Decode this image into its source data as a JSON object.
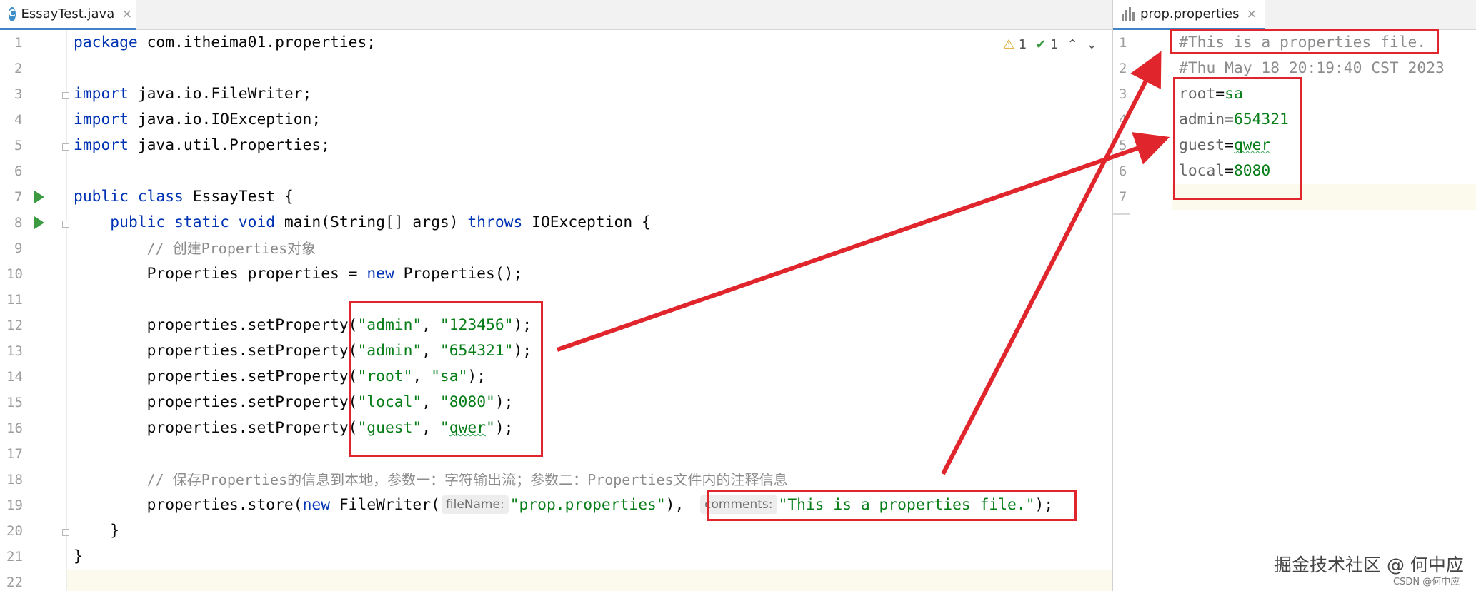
{
  "left_tab": {
    "icon": "java-class-icon",
    "label": "EssayTest.java",
    "close": "×"
  },
  "right_tab": {
    "icon": "properties-file-icon",
    "label": "prop.properties",
    "close": "×"
  },
  "inspections": {
    "warnings": "1",
    "weak_warnings": "1",
    "up": "⌃",
    "down": "⌄"
  },
  "editor": {
    "line_numbers": [
      "1",
      "2",
      "3",
      "4",
      "5",
      "6",
      "7",
      "8",
      "9",
      "10",
      "11",
      "12",
      "13",
      "14",
      "15",
      "16",
      "17",
      "18",
      "19",
      "20",
      "21",
      "22"
    ],
    "tokens": {
      "l1_kw": "package",
      "l1_rest": " com.itheima01.properties;",
      "l3_kw": "import",
      "l3_rest": " java.io.FileWriter;",
      "l4_kw": "import",
      "l4_rest": " java.io.IOException;",
      "l5_kw": "import",
      "l5_rest": " java.util.Properties;",
      "l7_kw": "public class",
      "l7_rest": " EssayTest {",
      "l8_indent": "    ",
      "l8_kw1": "public static void",
      "l8_mid": " main(String[] args) ",
      "l8_kw2": "throws",
      "l8_rest": " IOException {",
      "l9_indent": "        ",
      "l9_cmt": "// 创建Properties对象",
      "l10_indent": "        ",
      "l10_a": "Properties properties = ",
      "l10_kw": "new",
      "l10_b": " Properties();",
      "call_indent": "        ",
      "setProperty": "properties.setProperty(",
      "q": "\"",
      "comma": ", ",
      "close": ");",
      "l12_k": "\"admin\"",
      "l12_v": "\"123456\"",
      "l13_k": "\"admin\"",
      "l13_v": "\"654321\"",
      "l14_k": "\"root\"",
      "l14_v": "\"sa\"",
      "l15_k": "\"local\"",
      "l15_v": "\"8080\"",
      "l16_k": "\"guest\"",
      "l16_v_pre": "\"",
      "l16_v_word": "qwer",
      "l16_v_post": "\"",
      "l18_indent": "        ",
      "l18_cmt": "// 保存Properties的信息到本地，参数一：字符输出流；参数二：Properties文件内的注释信息",
      "l19_indent": "        ",
      "l19_a": "properties.store(",
      "l19_kw": "new",
      "l19_b": " FileWriter(",
      "l19_hint1": "fileName:",
      "l19_str1": "\"prop.properties\"",
      "l19_c": "), ",
      "l19_hint2": "comments:",
      "l19_str2": "\"This is a properties file.\"",
      "l19_d": ");",
      "l20_indent": "    ",
      "l20": "}",
      "l21": "}"
    }
  },
  "properties_file": {
    "line_numbers": [
      "1",
      "2",
      "3",
      "4",
      "5",
      "6",
      "7"
    ],
    "lines": [
      {
        "text": "#This is a properties file."
      },
      {
        "text": "#Thu May 18 20:19:40 CST 2023"
      },
      {
        "key": "root",
        "eq": "=",
        "value": "sa"
      },
      {
        "key": "admin",
        "eq": "=",
        "value": "654321"
      },
      {
        "key": "guest",
        "eq": "=",
        "value": "qwer"
      },
      {
        "key": "local",
        "eq": "=",
        "value": "8080"
      }
    ]
  },
  "watermark": {
    "main": "掘金技术社区 @ 何中应",
    "sub": "CSDN @何中应"
  },
  "colors": {
    "annotation_red": "#e0262c",
    "keyword": "#0033b3",
    "string": "#067d17",
    "comment": "#8c8c8c"
  }
}
